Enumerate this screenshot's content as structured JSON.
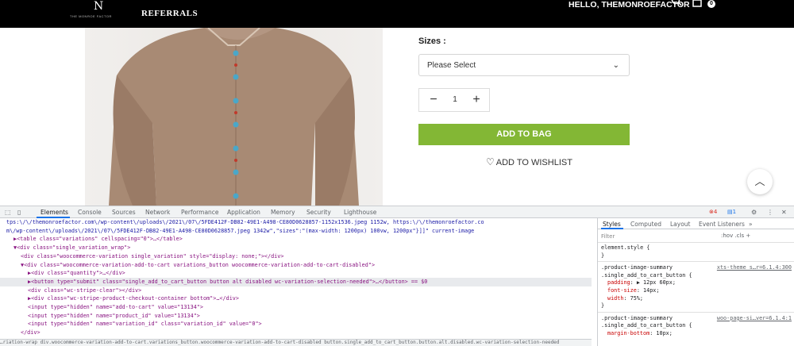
{
  "nav": {
    "logo_mark": "N",
    "logo_text": "THE MONROE FACTOR",
    "referrals": "REFERRALS",
    "greeting": "HELLO, THEMONROEFACTOR",
    "cart_count": "0"
  },
  "product": {
    "sizes_label": "Sizes :",
    "size_value": "Please Select",
    "quantity": "1",
    "add_to_bag": "ADD TO BAG",
    "wishlist": "ADD TO WISHLIST"
  },
  "devtools": {
    "tabs": [
      "Elements",
      "Console",
      "Sources",
      "Network",
      "Performance",
      "Application",
      "Memory",
      "Security",
      "Lighthouse"
    ],
    "error_count": "4",
    "message_count": "1",
    "element_lines": [
      {
        "indent": 0,
        "html": "tps:\\/\\/themonroefactor.com\\/wp-content\\/uploads\\/2021\\/07\\/5FDE412F-DB82-49E1-A498-CE80D0628857-1152x1536.jpeg 1152w, https:\\/\\/themonroefactor.co"
      },
      {
        "indent": 0,
        "html": "m\\/wp-content\\/uploads\\/2021\\/07\\/5FDE412F-DB82-49E1-A498-CE80D0628857.jpeg 1342w\",\"sizes\":\"(max-width: 1200px) 100vw, 1200px\"}]]\"  current-image"
      },
      {
        "indent": 1,
        "html": "▶<table class=\"variations\" cellspacing=\"0\">…</table>"
      },
      {
        "indent": 1,
        "html": "▼<div class=\"single_variation_wrap\">"
      },
      {
        "indent": 2,
        "html": "<div class=\"woocommerce-variation single_variation\" style=\"display: none;\"></div>"
      },
      {
        "indent": 2,
        "html": "▼<div class=\"woocommerce-variation-add-to-cart variations_button woocommerce-variation-add-to-cart-disabled\">"
      },
      {
        "indent": 3,
        "html": "▶<div class=\"quantity\">…</div>"
      },
      {
        "indent": 3,
        "html": "▶<button type=\"submit\" class=\"single_add_to_cart_button button alt disabled wc-variation-selection-needed\">…</button>  == $0"
      },
      {
        "indent": 3,
        "html": "<div class=\"wc-stripe-clear\"></div>"
      },
      {
        "indent": 3,
        "html": "▶<div class=\"wc-stripe-product-checkout-container bottom\">…</div>"
      },
      {
        "indent": 3,
        "html": "<input type=\"hidden\" name=\"add-to-cart\" value=\"13134\">"
      },
      {
        "indent": 3,
        "html": "<input type=\"hidden\" name=\"product_id\" value=\"13134\">"
      },
      {
        "indent": 3,
        "html": "<input type=\"hidden\" name=\"variation_id\" class=\"variation_id\" value=\"0\">"
      },
      {
        "indent": 2,
        "html": "</div>"
      }
    ],
    "selected_line": 7,
    "breadcrumbs": "…riation-wrap   div.woocommerce-variation-add-to-cart.variations_button.woocommerce-variation-add-to-cart-disabled   button.single_add_to_cart_button.button.alt.disabled.wc-variation-selection-needed",
    "styles_tabs": [
      "Styles",
      "Computed",
      "Layout",
      "Event Listeners",
      "»"
    ],
    "filter_placeholder": "Filter",
    "filter_tools": ":hov  .cls  +",
    "rules": [
      {
        "type": "selector",
        "text": "element.style {"
      },
      {
        "type": "close",
        "text": "}"
      },
      {
        "type": "selector",
        "text": ".product-image-summary",
        "source": "xts-theme_s…r=6.1.4:300"
      },
      {
        "type": "selector",
        "text": ".single_add_to_cart_button {"
      },
      {
        "type": "prop",
        "name": "padding",
        "value": "▶ 12px 60px;"
      },
      {
        "type": "prop",
        "name": "font-size",
        "value": "14px;"
      },
      {
        "type": "prop",
        "name": "width",
        "value": "75%;"
      },
      {
        "type": "close",
        "text": "}"
      },
      {
        "type": "selector",
        "text": ".product-image-summary",
        "source": "woo-page-si…ver=6.1.4:1"
      },
      {
        "type": "selector",
        "text": ".single_add_to_cart_button {"
      },
      {
        "type": "prop",
        "name": "margin-bottom",
        "value": "10px;"
      }
    ]
  }
}
